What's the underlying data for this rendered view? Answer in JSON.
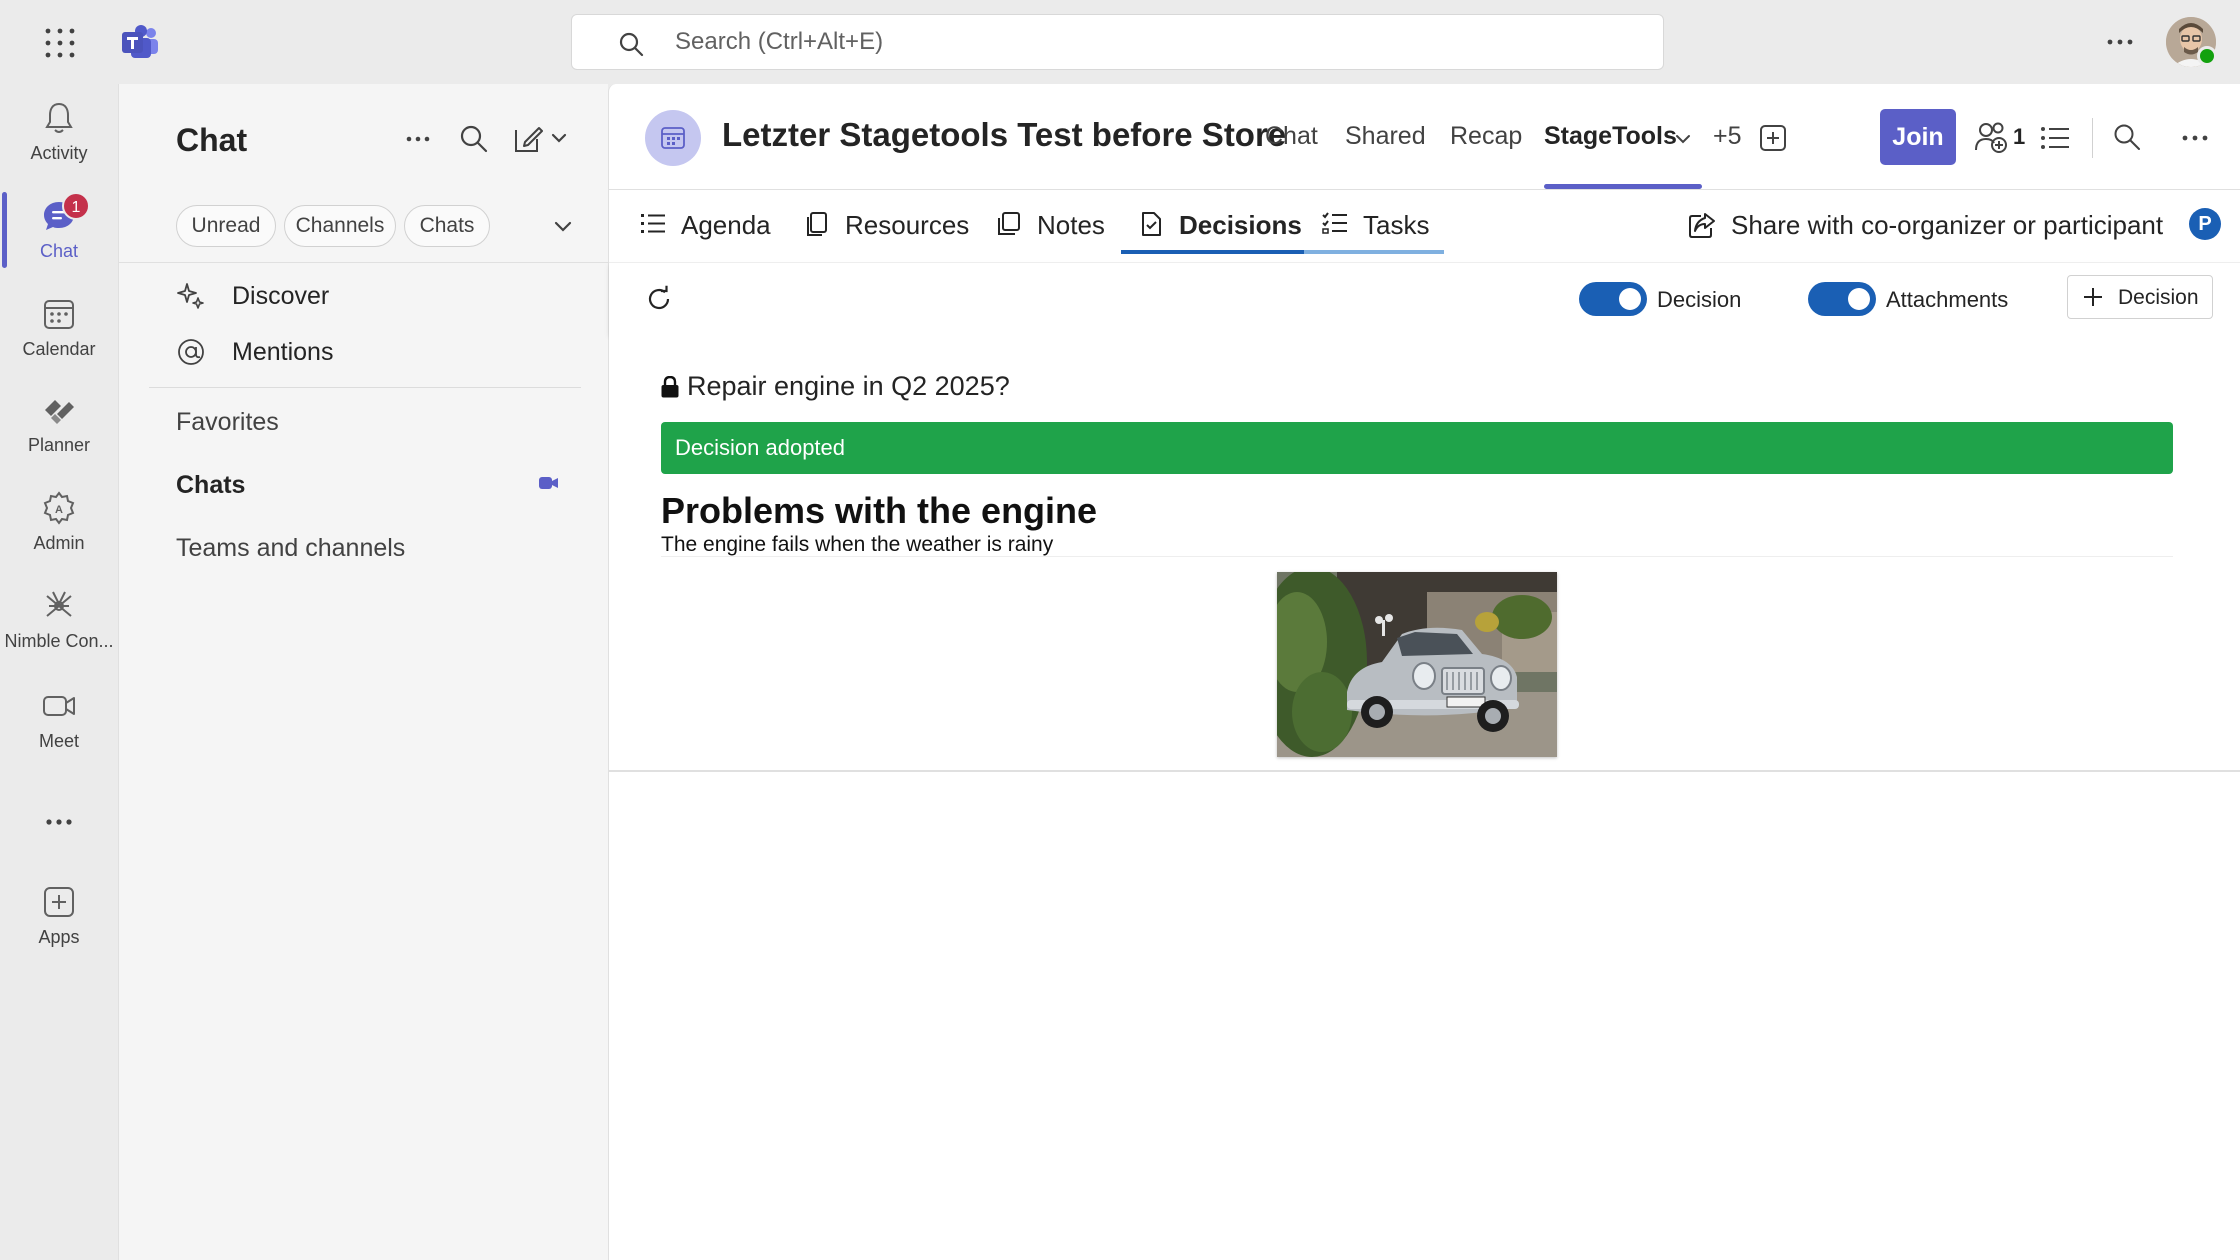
{
  "titlebar": {
    "search_placeholder": "Search (Ctrl+Alt+E)"
  },
  "rail": {
    "items": [
      {
        "label": "Activity",
        "icon": "bell-icon"
      },
      {
        "label": "Chat",
        "icon": "chat-icon",
        "badge": "1"
      },
      {
        "label": "Calendar",
        "icon": "calendar-icon"
      },
      {
        "label": "Planner",
        "icon": "planner-icon"
      },
      {
        "label": "Admin",
        "icon": "admin-icon"
      },
      {
        "label": "Nimble Con...",
        "icon": "nimble-icon"
      },
      {
        "label": "Meet",
        "icon": "video-icon"
      },
      {
        "label": "Apps",
        "icon": "add-app-icon"
      }
    ]
  },
  "chat_pane": {
    "title": "Chat",
    "filters": [
      "Unread",
      "Channels",
      "Chats"
    ],
    "nav": [
      {
        "label": "Discover",
        "icon": "sparkle-icon"
      },
      {
        "label": "Mentions",
        "icon": "mention-icon"
      }
    ],
    "sections": {
      "favorites": "Favorites",
      "chats": "Chats",
      "teams": "Teams and channels"
    }
  },
  "meeting": {
    "title": "Letzter Stagetools Test before Store",
    "tabs": [
      "Chat",
      "Shared",
      "Recap",
      "StageTools",
      "+5"
    ],
    "active_tab": "StageTools",
    "join_label": "Join",
    "participants_count": "1"
  },
  "app": {
    "tabs": [
      {
        "label": "Agenda",
        "icon": "agenda-icon"
      },
      {
        "label": "Resources",
        "icon": "resources-icon"
      },
      {
        "label": "Notes",
        "icon": "notes-icon"
      },
      {
        "label": "Decisions",
        "icon": "decisions-icon"
      },
      {
        "label": "Tasks",
        "icon": "tasks-icon"
      }
    ],
    "active_tab": "Decisions",
    "share_label": "Share with co-organizer or participant",
    "user_initial": "P",
    "toolbar": {
      "toggle_decision_label": "Decision",
      "toggle_decision_on": true,
      "toggle_attachments_label": "Attachments",
      "toggle_attachments_on": true,
      "add_decision_label": "Decision"
    },
    "decision": {
      "question": "Repair engine in Q2 2025?",
      "status": "Decision adopted",
      "heading": "Problems with the engine",
      "description": "The engine fails when the weather is rainy"
    }
  },
  "colors": {
    "brand": "#5b5fc7",
    "app_accent": "#1a5fb4",
    "adopted_green": "#1fa34a",
    "badge_red": "#c4314b"
  }
}
